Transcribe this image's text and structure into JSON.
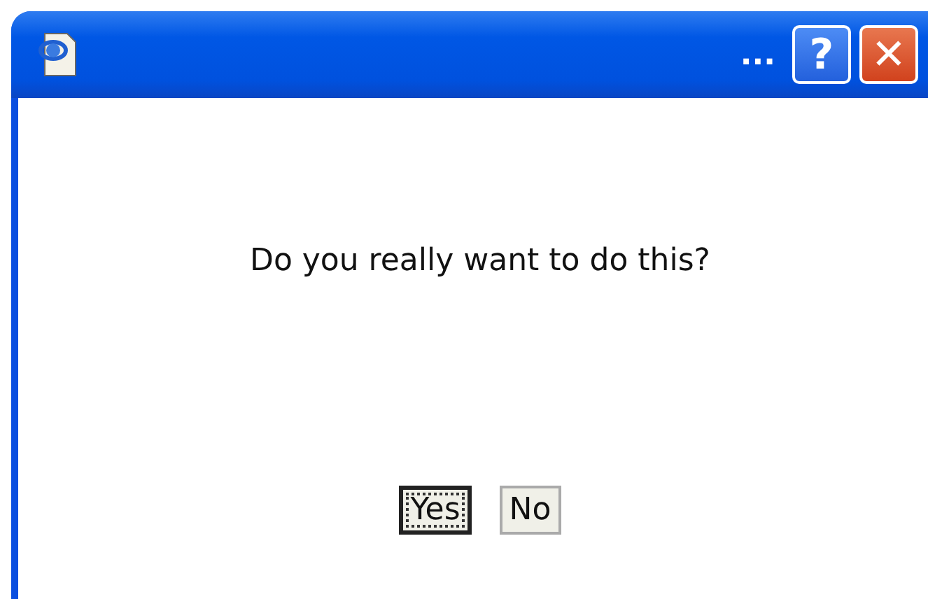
{
  "window": {
    "title": "...",
    "help_button": "?",
    "close_button": "✕"
  },
  "message": "Do you really want to do this?",
  "buttons": [
    {
      "label": "Yes",
      "selected": true
    },
    {
      "label": "No",
      "selected": false
    }
  ]
}
